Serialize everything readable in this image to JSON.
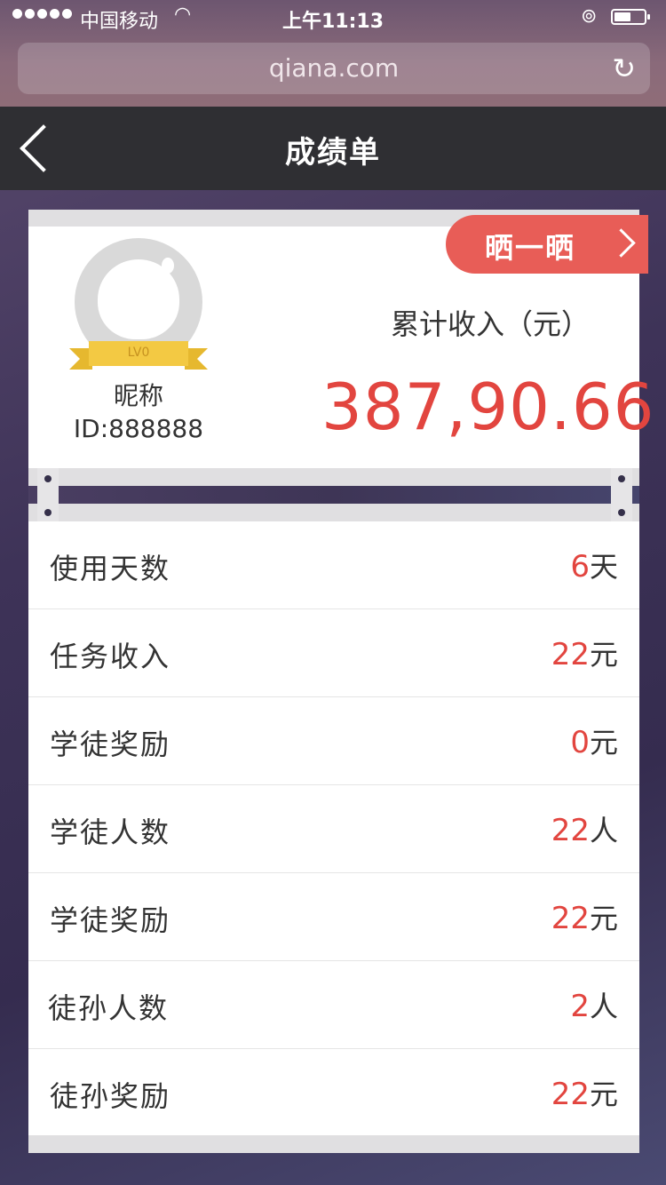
{
  "status_bar": {
    "carrier": "中国移动",
    "time": "上午11:13"
  },
  "browser": {
    "url": "qiana.com"
  },
  "nav": {
    "title": "成绩单"
  },
  "profile": {
    "share_label": "晒一晒",
    "level": "LV0",
    "nickname": "昵称",
    "user_id": "ID:888888",
    "income_label": "累计收入（元）",
    "income_value": "387,90.66"
  },
  "stats": [
    {
      "label": "使用天数",
      "value": "6",
      "unit": "天"
    },
    {
      "label": "任务收入",
      "value": "22",
      "unit": "元"
    },
    {
      "label": "学徒奖励",
      "value": "0",
      "unit": "元"
    },
    {
      "label": "学徒人数",
      "value": "22",
      "unit": "人"
    },
    {
      "label": "学徒奖励",
      "value": "22",
      "unit": "元"
    },
    {
      "label": "徒孙人数",
      "value": "2",
      "unit": "人"
    },
    {
      "label": "徒孙奖励",
      "value": "22",
      "unit": "元"
    }
  ],
  "colors": {
    "accent": "#e2453f",
    "share_tag": "#e85d57",
    "nav_bg": "#2f2f33"
  }
}
